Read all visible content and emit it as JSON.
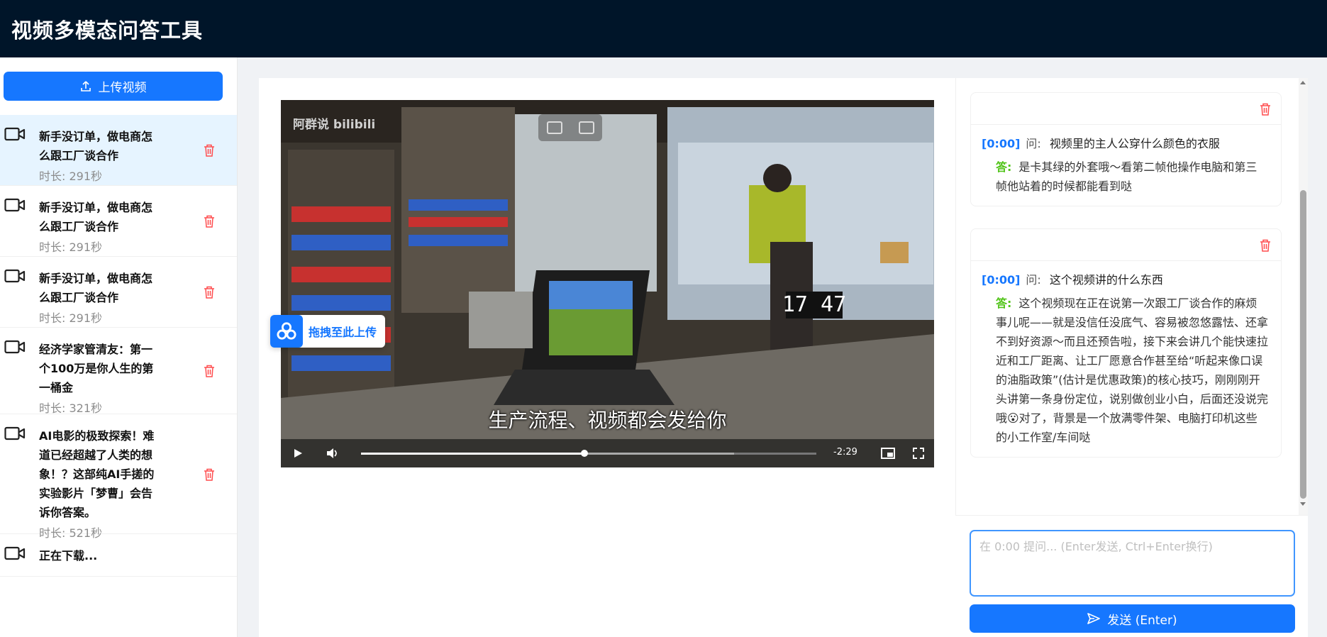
{
  "app": {
    "title": "视频多模态问答工具"
  },
  "sidebar": {
    "upload_label": "上传视频",
    "items": [
      {
        "title": "新手没订单，做电商怎么跟工厂谈合作",
        "duration": "时长: 291秒",
        "active": true
      },
      {
        "title": "新手没订单，做电商怎么跟工厂谈合作",
        "duration": "时长: 291秒",
        "active": false
      },
      {
        "title": "新手没订单，做电商怎么跟工厂谈合作",
        "duration": "时长: 291秒",
        "active": false
      },
      {
        "title": "经济学家管清友：第一个100万是你人生的第一桶金",
        "duration": "时长: 321秒",
        "active": false
      },
      {
        "title": "AI电影的极致探索！难道已经超越了人类的想象！？这部纯AI手搓的实验影片「梦曹」会告诉你答案。",
        "duration": "时长: 521秒",
        "active": false
      },
      {
        "title": "正在下载...",
        "duration": "",
        "active": false
      }
    ]
  },
  "player": {
    "watermark": "阿群说 bilibili",
    "subtitle": "生产流程、视频都会发给你",
    "remaining_time": "-2:29",
    "progress": 0.49,
    "buffered": 0.82,
    "drag_tip": "拖拽至此上传"
  },
  "qa": [
    {
      "timestamp": "[0:00]",
      "question_label": "问:",
      "question": "视频里的主人公穿什么颜色的衣服",
      "answer_label": "答:",
      "answer": "是卡其绿的外套哦～看第二帧他操作电脑和第三帧他站着的时候都能看到哒"
    },
    {
      "timestamp": "[0:00]",
      "question_label": "问:",
      "question": "这个视频讲的什么东西",
      "answer_label": "答:",
      "answer": "这个视频现在正在说第一次跟工厂谈合作的麻烦事儿呢——就是没信任没底气、容易被忽悠露怯、还拿不到好资源～而且还预告啦，接下来会讲几个能快速拉近和工厂距离、让工厂愿意合作甚至给“听起来像口误的油脂政策”(估计是优惠政策)的核心技巧，刚刚刚开头讲第一条身份定位，说别做创业小白，后面还没说完哦😮对了，背景是一个放满零件架、电脑打印机这些的小工作室/车间哒"
    }
  ],
  "input": {
    "placeholder": "在 0:00 提问... (Enter发送, Ctrl+Enter换行)",
    "value": "",
    "send_label": "发送 (Enter)"
  },
  "colors": {
    "header_bg": "#001529",
    "primary": "#1677ff",
    "danger": "#ff4d4f",
    "answer_label": "#52c41a",
    "active_item_bg": "#e6f4ff"
  }
}
